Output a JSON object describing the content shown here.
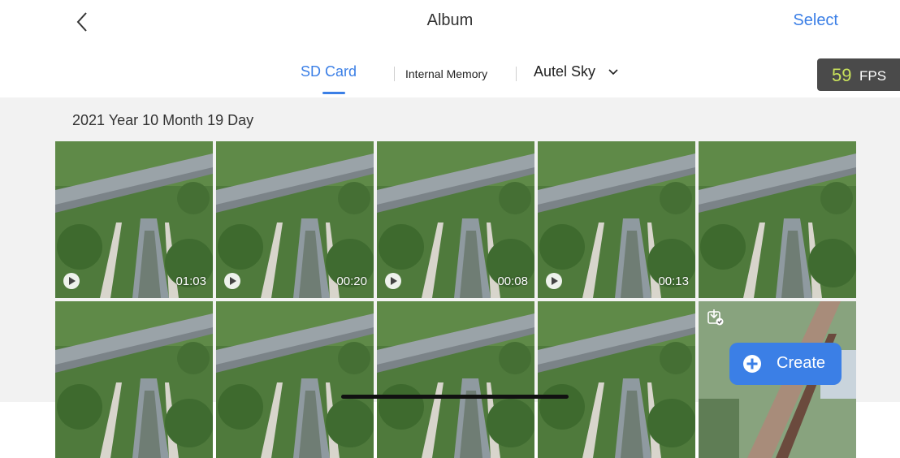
{
  "header": {
    "title": "Album",
    "select_label": "Select"
  },
  "tabs": [
    {
      "label": "SD Card",
      "active": true
    },
    {
      "label": "Internal Memory",
      "active": false
    },
    {
      "label": "Autel Sky",
      "active": false
    }
  ],
  "fps": {
    "value": "59",
    "unit": "FPS"
  },
  "section": {
    "date_label": "2021 Year 10 Month 19 Day"
  },
  "media": [
    {
      "type": "video",
      "duration": "01:03"
    },
    {
      "type": "video",
      "duration": "00:20"
    },
    {
      "type": "video",
      "duration": "00:08"
    },
    {
      "type": "video",
      "duration": "00:13"
    },
    {
      "type": "photo"
    },
    {
      "type": "photo"
    },
    {
      "type": "photo"
    },
    {
      "type": "photo"
    },
    {
      "type": "photo"
    },
    {
      "type": "photo",
      "downloaded": true
    }
  ],
  "create_button": {
    "label": "Create"
  },
  "colors": {
    "accent": "#3b7fe6",
    "fps_value": "#c9e25b",
    "fps_bg": "#4a4a4a",
    "content_bg": "#f2f2f2"
  },
  "icons": {
    "back": "chevron-left-icon",
    "dropdown": "chevron-down-icon",
    "play": "play-icon",
    "downloaded": "download-check-icon",
    "create": "plus-circle-icon"
  }
}
